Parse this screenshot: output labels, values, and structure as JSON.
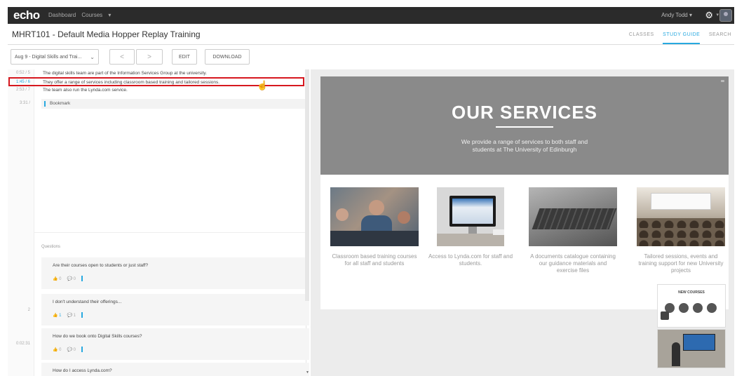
{
  "topbar": {
    "logo": "echo",
    "nav": [
      "Dashboard",
      "Courses",
      "▾"
    ],
    "user": "Andy Todd  ▾",
    "gear_caret": "▾"
  },
  "header": {
    "course_title": "MHRT101 - Default Media Hopper Replay Training",
    "tabs": [
      {
        "label": "CLASSES",
        "active": false
      },
      {
        "label": "STUDY GUIDE",
        "active": true
      },
      {
        "label": "SEARCH",
        "active": false
      }
    ]
  },
  "toolbar": {
    "class_select": "Aug 9 - Digital Skills and Trai...",
    "prev": "<",
    "next": ">",
    "edit": "EDIT",
    "download": "DOWNLOAD"
  },
  "notes": {
    "lines": [
      {
        "nums": "0:52  /  5",
        "text": "The digital skills team are part of the Information Services Group at the university."
      },
      {
        "nums": "1:45  /  6",
        "text": "They offer a range of services including classroom based training and tailored sessions."
      },
      {
        "nums": "2:53  /  7",
        "text": "The team also run the Lynda.com service."
      }
    ],
    "bookmark_time": "3:31  /",
    "bookmark": "Bookmark"
  },
  "questions": {
    "label": "Questions",
    "side_counter": "2",
    "side_time": "0:02:31",
    "items": [
      {
        "text": "Are their courses open to students or just staff?",
        "likes": "0",
        "comments": "0"
      },
      {
        "text": "I don't understand their offerings...",
        "likes": "1",
        "comments": "1"
      },
      {
        "text": "How do we book onto Digital Skills courses?",
        "likes": "0",
        "comments": "0"
      },
      {
        "text": "How do I access Lynda.com?",
        "likes": "",
        "comments": ""
      }
    ]
  },
  "slide": {
    "title": "OUR SERVICES",
    "subtitle_1": "We provide a range of services to both staff and",
    "subtitle_2": "students at The University of Edinburgh",
    "services": [
      {
        "caption": "Classroom based training courses for all staff and students"
      },
      {
        "caption": "Access to Lynda.com for staff and students."
      },
      {
        "caption": "A documents catalogue containing our guidance materials and exercise files"
      },
      {
        "caption": "Tailored sessions, events and training support for new University projects"
      }
    ],
    "thumb_title": "NEW COURSES"
  },
  "colors": {
    "accent": "#28a9e0",
    "highlight": "#d6181f",
    "topbar": "#2b2b2b",
    "slide_header": "#8a8a8a"
  }
}
